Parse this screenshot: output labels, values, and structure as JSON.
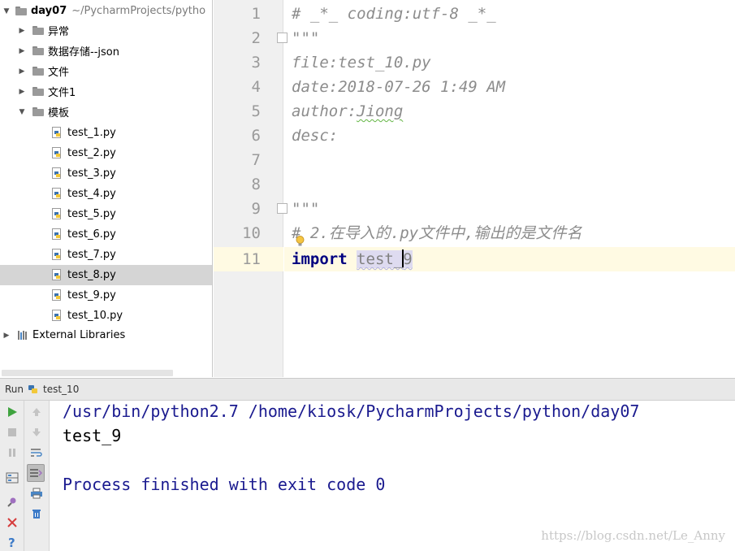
{
  "project_tree": {
    "root": {
      "name": "day07",
      "path": "~/PycharmProjects/pytho"
    },
    "folders_before": [
      {
        "label": "异常",
        "expanded": false
      },
      {
        "label": "数据存储--json",
        "expanded": false
      },
      {
        "label": "文件",
        "expanded": false
      },
      {
        "label": "文件1",
        "expanded": false
      }
    ],
    "open_folder": {
      "label": "模板",
      "expanded": true
    },
    "files": [
      "test_1.py",
      "test_2.py",
      "test_3.py",
      "test_4.py",
      "test_5.py",
      "test_6.py",
      "test_7.py",
      "test_8.py",
      "test_9.py",
      "test_10.py"
    ],
    "selected_file": "test_8.py",
    "external_libraries": "External Libraries"
  },
  "editor": {
    "line_numbers": [
      "1",
      "2",
      "3",
      "4",
      "5",
      "6",
      "7",
      "8",
      "9",
      "10",
      "11"
    ],
    "lines": {
      "l1": "# _*_ coding:utf-8 _*_",
      "l2": "\"\"\"",
      "l3": "file:test_10.py",
      "l4": "date:2018-07-26 1:49 AM",
      "l5_prefix": "author:",
      "l5_name": "Jiong",
      "l6": "desc:",
      "l9": "\"\"\"",
      "l10_hash": "#",
      "l10_rest": " 2.在导入的.py文件中,输出的是文件名",
      "l11_keyword": "import",
      "l11_module_a": "test_",
      "l11_module_b": "9"
    },
    "current_line": "11"
  },
  "run": {
    "tab_label": "Run",
    "config_name": "test_10",
    "console": {
      "command": "/usr/bin/python2.7 /home/kiosk/PycharmProjects/python/day07",
      "output": "test_9",
      "exit_message": "Process finished with exit code 0"
    }
  },
  "watermark": "https://blog.csdn.net/Le_Anny",
  "colors": {
    "keyword": "#000080",
    "comment": "#8c8c8c",
    "console_system": "#1a1a8f",
    "current_line": "#fffae3",
    "selection": "#d5d5d5"
  }
}
